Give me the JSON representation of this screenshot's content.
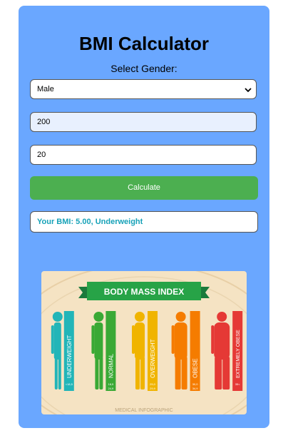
{
  "app": {
    "title": "BMI Calculator",
    "gender_label": "Select Gender:",
    "gender_selected": "Male",
    "weight_value": "200",
    "age_value": "20",
    "calculate_label": "Calculate",
    "result_text": "Your BMI: 5.00, Underweight"
  },
  "infographic": {
    "banner": "BODY MASS INDEX",
    "footer": "MEDICAL INFOGRAPHIC",
    "categories": [
      {
        "label": "UNDERWEIGHT",
        "range": "<18,5",
        "color": "#22b5b8"
      },
      {
        "label": "NORMAL",
        "range": "18,5\n24,9",
        "color": "#3aa935"
      },
      {
        "label": "OVERWEIGHT",
        "range": "25,0\n29,9",
        "color": "#f0b400"
      },
      {
        "label": "OBESE",
        "range": "30,0\n34,9",
        "color": "#f57c00"
      },
      {
        "label": "EXTREMELY OBESE",
        "range": "35<",
        "color": "#e53935"
      }
    ]
  },
  "colors": {
    "card_bg": "#6aa7ff",
    "button_bg": "#4caf50",
    "result_text": "#17a2b8",
    "autofill_bg": "#e8f0fe"
  }
}
